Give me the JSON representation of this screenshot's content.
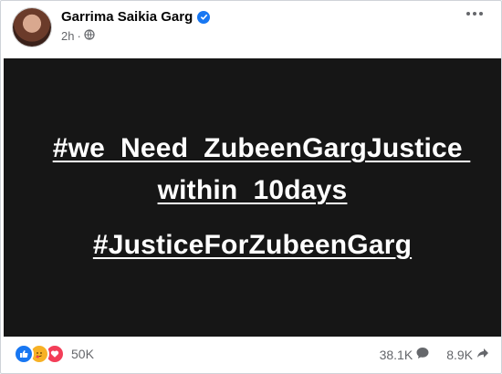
{
  "post": {
    "author": "Garrima Saikia Garg",
    "time": "2h",
    "separator": "·",
    "image_text": {
      "line1": "#we  Need  ZubeenGargJustice ",
      "line2": "within  10days",
      "line3": "#JusticeForZubeenGarg"
    },
    "reaction_count": "50K",
    "comment_count": "38.1K",
    "share_count": "8.9K"
  },
  "icons": {
    "verified": "verified-badge-icon",
    "audience": "globe-icon",
    "more": "more-options-icon",
    "reactions": [
      "like-icon",
      "care-icon",
      "love-icon"
    ],
    "comment": "comment-icon",
    "share": "share-icon"
  },
  "colors": {
    "brand_blue": "#1877f2",
    "image_background": "#161616",
    "secondary_text": "#65676b"
  }
}
